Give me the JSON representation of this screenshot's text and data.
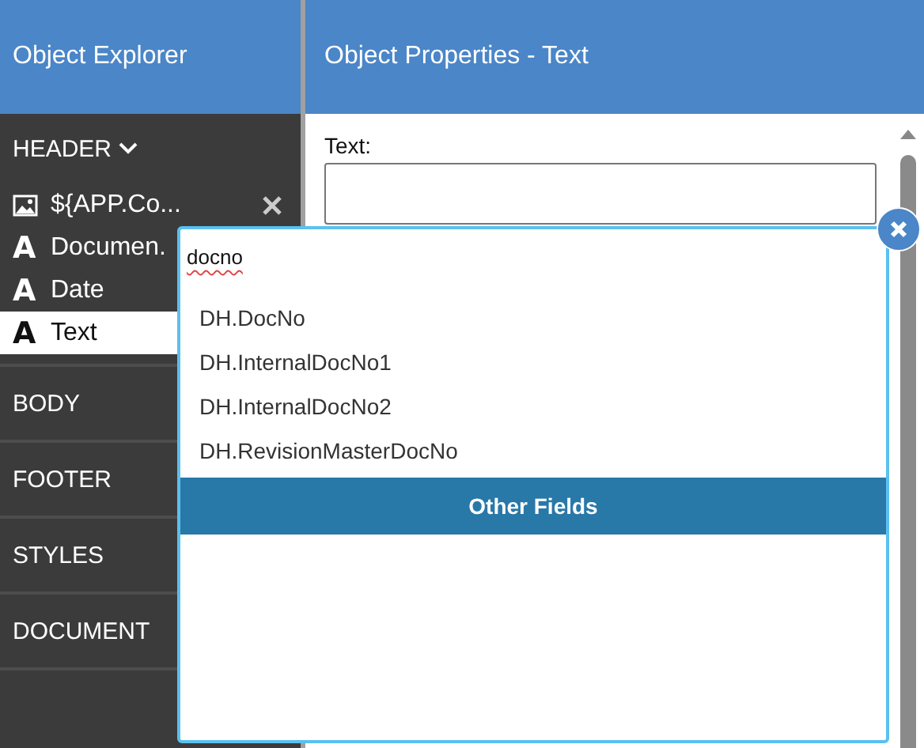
{
  "sidebar": {
    "title": "Object Explorer",
    "sections": [
      {
        "label": "HEADER",
        "expanded": true,
        "items": [
          {
            "kind": "image",
            "label": "${APP.Co...",
            "removable": true,
            "selected": false
          },
          {
            "kind": "text",
            "glyph": "A",
            "label": "Documen.",
            "removable": false,
            "selected": false
          },
          {
            "kind": "text",
            "glyph": "A",
            "label": "Date",
            "removable": false,
            "selected": false
          },
          {
            "kind": "text",
            "glyph": "A",
            "label": "Text",
            "removable": false,
            "selected": true
          }
        ]
      },
      {
        "label": "BODY",
        "expanded": false
      },
      {
        "label": "FOOTER",
        "expanded": false
      },
      {
        "label": "STYLES",
        "expanded": false
      },
      {
        "label": "DOCUMENT",
        "expanded": false
      }
    ]
  },
  "properties": {
    "title": "Object Properties - Text",
    "fields": [
      {
        "label": "Text:"
      }
    ]
  },
  "popup": {
    "query": "docno",
    "results": [
      "DH.DocNo",
      "DH.InternalDocNo1",
      "DH.InternalDocNo2",
      "DH.RevisionMasterDocNo"
    ],
    "action": "Other Fields"
  }
}
